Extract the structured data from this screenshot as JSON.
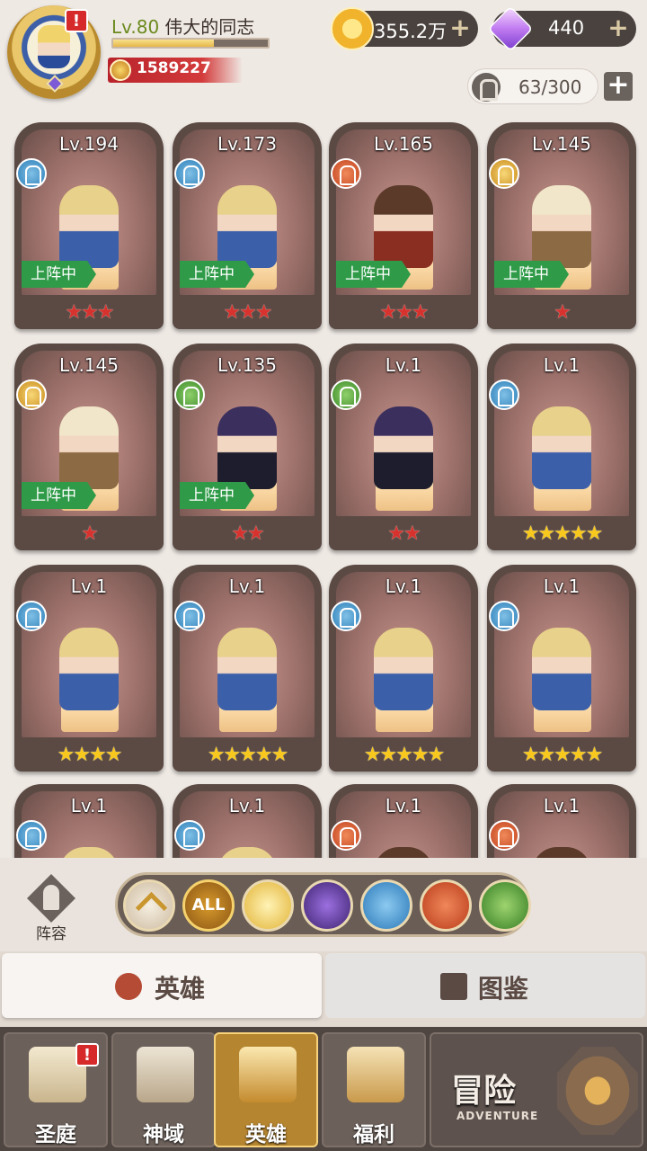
{
  "player": {
    "level": "Lv.80",
    "name": "伟大的同志",
    "xp_fraction": 0.65,
    "power": "1589227",
    "alert": "!"
  },
  "resources": {
    "gold": "355.2万",
    "gems": "440",
    "plus": "+"
  },
  "capacity": {
    "value": "63/300",
    "plus": "+"
  },
  "heroes": [
    {
      "level": "Lv.194",
      "element": "water",
      "deployed": true,
      "stars": "★★★",
      "star_color": "red"
    },
    {
      "level": "Lv.173",
      "element": "water",
      "deployed": true,
      "stars": "★★★",
      "star_color": "red"
    },
    {
      "level": "Lv.165",
      "element": "fire",
      "deployed": true,
      "stars": "★★★",
      "star_color": "red"
    },
    {
      "level": "Lv.145",
      "element": "light",
      "deployed": true,
      "stars": "★",
      "star_color": "red"
    },
    {
      "level": "Lv.145",
      "element": "light",
      "deployed": true,
      "stars": "★",
      "star_color": "red"
    },
    {
      "level": "Lv.135",
      "element": "wood",
      "deployed": true,
      "stars": "★★",
      "star_color": "red"
    },
    {
      "level": "Lv.1",
      "element": "wood",
      "deployed": false,
      "stars": "★★",
      "star_color": "red"
    },
    {
      "level": "Lv.1",
      "element": "water",
      "deployed": false,
      "stars": "★★★★★",
      "star_color": "yellow"
    },
    {
      "level": "Lv.1",
      "element": "water",
      "deployed": false,
      "stars": "★★★★",
      "star_color": "yellow"
    },
    {
      "level": "Lv.1",
      "element": "water",
      "deployed": false,
      "stars": "★★★★★",
      "star_color": "yellow"
    },
    {
      "level": "Lv.1",
      "element": "water",
      "deployed": false,
      "stars": "★★★★★",
      "star_color": "yellow"
    },
    {
      "level": "Lv.1",
      "element": "water",
      "deployed": false,
      "stars": "★★★★★",
      "star_color": "yellow"
    },
    {
      "level": "Lv.1",
      "element": "water",
      "deployed": false,
      "stars": "",
      "star_color": "yellow"
    },
    {
      "level": "Lv.1",
      "element": "water",
      "deployed": false,
      "stars": "",
      "star_color": "yellow"
    },
    {
      "level": "Lv.1",
      "element": "fire",
      "deployed": false,
      "stars": "",
      "star_color": "yellow"
    },
    {
      "level": "Lv.1",
      "element": "fire",
      "deployed": false,
      "stars": "",
      "star_color": "yellow"
    }
  ],
  "deployed_label": "上阵中",
  "filter": {
    "lineup_label": "阵容",
    "all_label": "ALL",
    "icons": [
      "sort-up-icon",
      "all-icon",
      "light-element-icon",
      "dark-element-icon",
      "water-element-icon",
      "fire-element-icon",
      "wood-element-icon"
    ]
  },
  "tabs": {
    "heroes": "英雄",
    "codex": "图鉴"
  },
  "nav": {
    "court": "圣庭",
    "divine": "神域",
    "heroes": "英雄",
    "welfare": "福利",
    "adventure": "冒险",
    "adventure_en": "ADVENTURE"
  },
  "colors": {
    "deployed_badge": "#2f9b48",
    "star_red": "#d8322e",
    "star_yellow": "#f8c81d",
    "nav_active": "#b58530"
  }
}
